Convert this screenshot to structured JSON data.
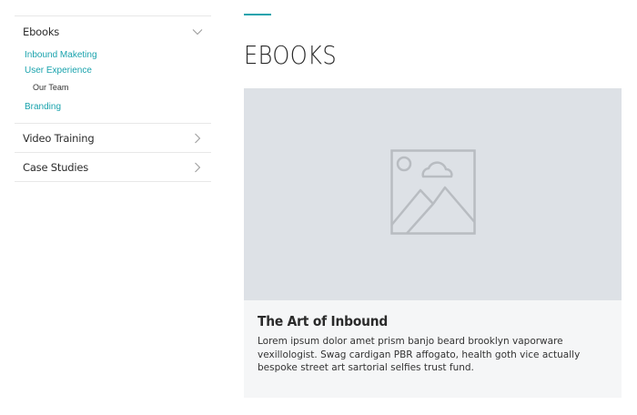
{
  "sidebar": {
    "sections": [
      {
        "label": "Ebooks",
        "state": "expanded",
        "items": [
          {
            "label": "Inbound Maketing"
          },
          {
            "label": "User Experience"
          },
          {
            "label": "Our Team"
          },
          {
            "label": "Branding"
          }
        ]
      },
      {
        "label": "Video Training",
        "state": "collapsed"
      },
      {
        "label": "Case Studies",
        "state": "collapsed"
      }
    ]
  },
  "main": {
    "title": "EBOOKS",
    "card": {
      "image_icon": "image-placeholder-icon",
      "title": "The Art of Inbound",
      "text": "Lorem ipsum dolor amet prism banjo beard brooklyn vaporware vexillologist. Swag cardigan PBR affogato, health goth vice actually bespoke street art sartorial selfies trust fund."
    }
  },
  "colors": {
    "accent": "#1aa3ad",
    "image_bg": "#dde1e6",
    "card_bg": "#f5f6f7",
    "divider": "#e8e8e8"
  }
}
